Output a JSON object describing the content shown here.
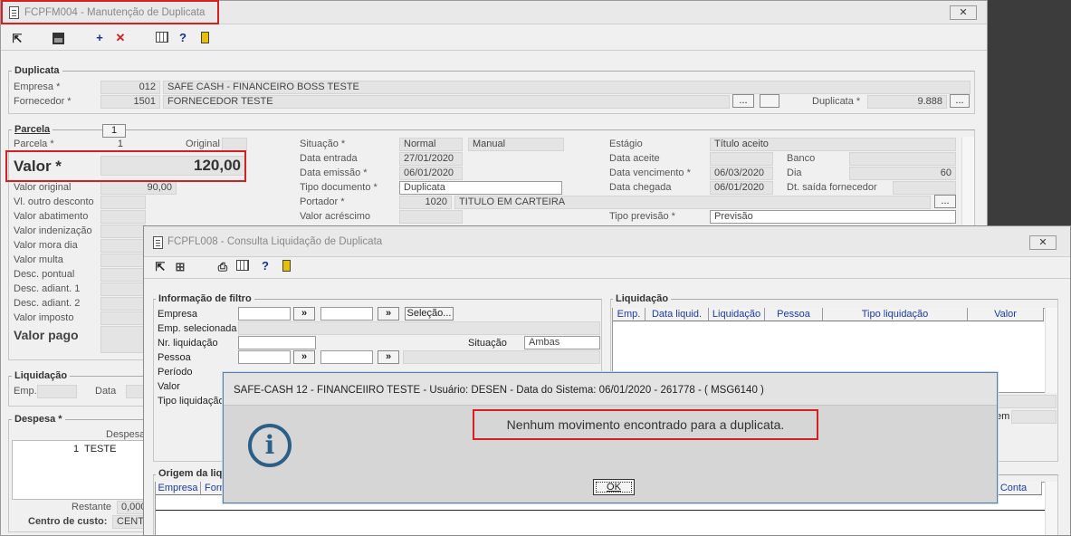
{
  "main": {
    "title": "FCPFM004 - Manutenção de Duplicata",
    "dup": {
      "title": "Duplicata",
      "empresa_label": "Empresa *",
      "empresa_code": "012",
      "empresa_name": "SAFE CASH - FINANCEIRO BOSS TESTE",
      "fornecedor_label": "Fornecedor *",
      "fornecedor_code": "1501",
      "fornecedor_name": "FORNECEDOR TESTE",
      "duplicata_label": "Duplicata *",
      "duplicata_value": "9.888",
      "ellipsis": "..."
    },
    "parcela": {
      "title": "Parcela",
      "tab": "1",
      "parcela_label": "Parcela *",
      "parcela_value": "1",
      "original_label": "Original",
      "valor_label": "Valor *",
      "valor_value": "120,00",
      "valor_original_label": "Valor original",
      "valor_original_value": "90,00",
      "others": [
        "Vl. outro desconto",
        "Valor abatimento",
        "Valor indenização",
        "Valor mora dia",
        "Valor multa",
        "Desc. pontual",
        "Desc. adiant. 1",
        "Desc. adiant. 2",
        "Valor imposto"
      ],
      "valor_pago_label": "Valor pago"
    },
    "mid": {
      "situacao_label": "Situação *",
      "situacao_value": "Normal",
      "situacao_extra": "Manual",
      "entrada_label": "Data entrada",
      "entrada_value": "27/01/2020",
      "emissao_label": "Data emissão *",
      "emissao_value": "06/01/2020",
      "tipodoc_label": "Tipo documento *",
      "tipodoc_value": "Duplicata",
      "portador_label": "Portador *",
      "portador_code": "1020",
      "portador_name": "TITULO EM CARTEIRA",
      "acrescimo_label": "Valor acréscimo"
    },
    "right": {
      "estagio_label": "Estágio",
      "estagio_value": "Título aceito",
      "aceite_label": "Data aceite",
      "banco_label": "Banco",
      "venc_label": "Data vencimento *",
      "venc_value": "06/03/2020",
      "dia_label": "Dia",
      "dia_value": "60",
      "chegada_label": "Data chegada",
      "chegada_value": "06/01/2020",
      "saida_label": "Dt. saída fornecedor",
      "previsao_label": "Tipo previsão *",
      "previsao_value": "Previsão"
    },
    "liq": {
      "title": "Liquidação",
      "emp_label": "Emp.",
      "data_label": "Data"
    },
    "despesa": {
      "title": "Despesa *",
      "col": "Despesa",
      "row_num": "1",
      "row_name": "TESTE",
      "restante_label": "Restante",
      "restante_value": "0,000",
      "centro_label": "Centro de custo:",
      "centro_value": "CENTR"
    }
  },
  "consulta": {
    "title": "FCPFL008 - Consulta Liquidação de Duplicata",
    "filtro": {
      "title": "Informação de filtro",
      "empresa_label": "Empresa",
      "arrow": "»",
      "selecao_btn": "Seleção...",
      "empsel_label": "Emp. selecionada",
      "nrliq_label": "Nr. liquidação",
      "situacao_label": "Situação",
      "situacao_value": "Ambas",
      "pessoa_label": "Pessoa",
      "periodo_label": "Período",
      "valor_label": "Valor",
      "tipoliq_label": "Tipo liquidação"
    },
    "liquidacao": {
      "title": "Liquidação",
      "cols": [
        "Emp.",
        "Data liquid.",
        "Liquidação",
        "Pessoa",
        "Tipo liquidação",
        "Valor"
      ]
    },
    "origem": {
      "title": "Origem da liq",
      "cols": [
        "Empresa",
        "Forn"
      ],
      "conta_col": "Conta"
    },
    "partial": "em"
  },
  "dialog": {
    "title": "SAFE-CASH 12 - FINANCEIIRO TESTE - Usuário: DESEN - Data do Sistema: 06/01/2020 - 261778 - ( MSG6140 )",
    "message": "Nenhum movimento encontrado para a duplicata.",
    "ok": "OK",
    "icon": "info-icon"
  },
  "colors": {
    "highlight": "#d42020",
    "dialog_bg": "#d6d6d6",
    "info_blue": "#2b5f87",
    "header_text": "#1a3aa8"
  }
}
